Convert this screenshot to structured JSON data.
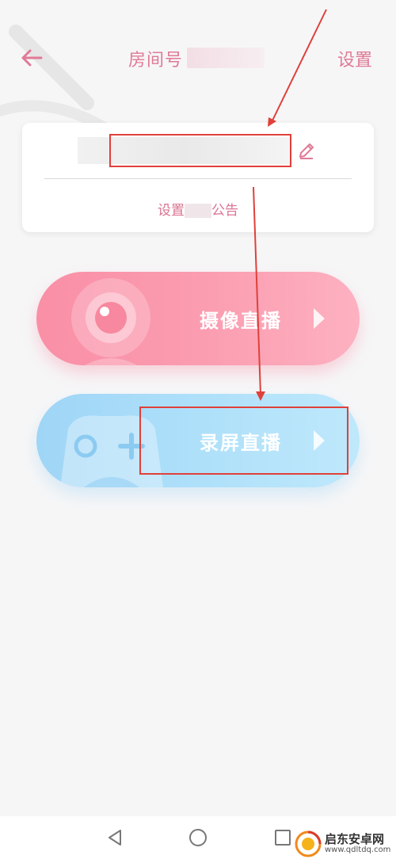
{
  "header": {
    "title": "房间号",
    "settings_label": "设置"
  },
  "room_card": {
    "notice_prefix": "设置",
    "notice_suffix": "公告"
  },
  "live_options": [
    {
      "label": "摄像直播",
      "icon": "camera-icon"
    },
    {
      "label": "录屏直播",
      "icon": "gamepad-icon"
    }
  ],
  "nav": [
    "back-triangle-icon",
    "home-circle-icon",
    "recents-square-icon"
  ],
  "watermark": {
    "name": "启东安卓网",
    "url": "www.qdltdq.com"
  },
  "colors": {
    "accent": "#e07a96",
    "camera_pill": "#f98fa6",
    "screen_pill": "#9fd5f6",
    "annotation_red": "#e0403a"
  }
}
